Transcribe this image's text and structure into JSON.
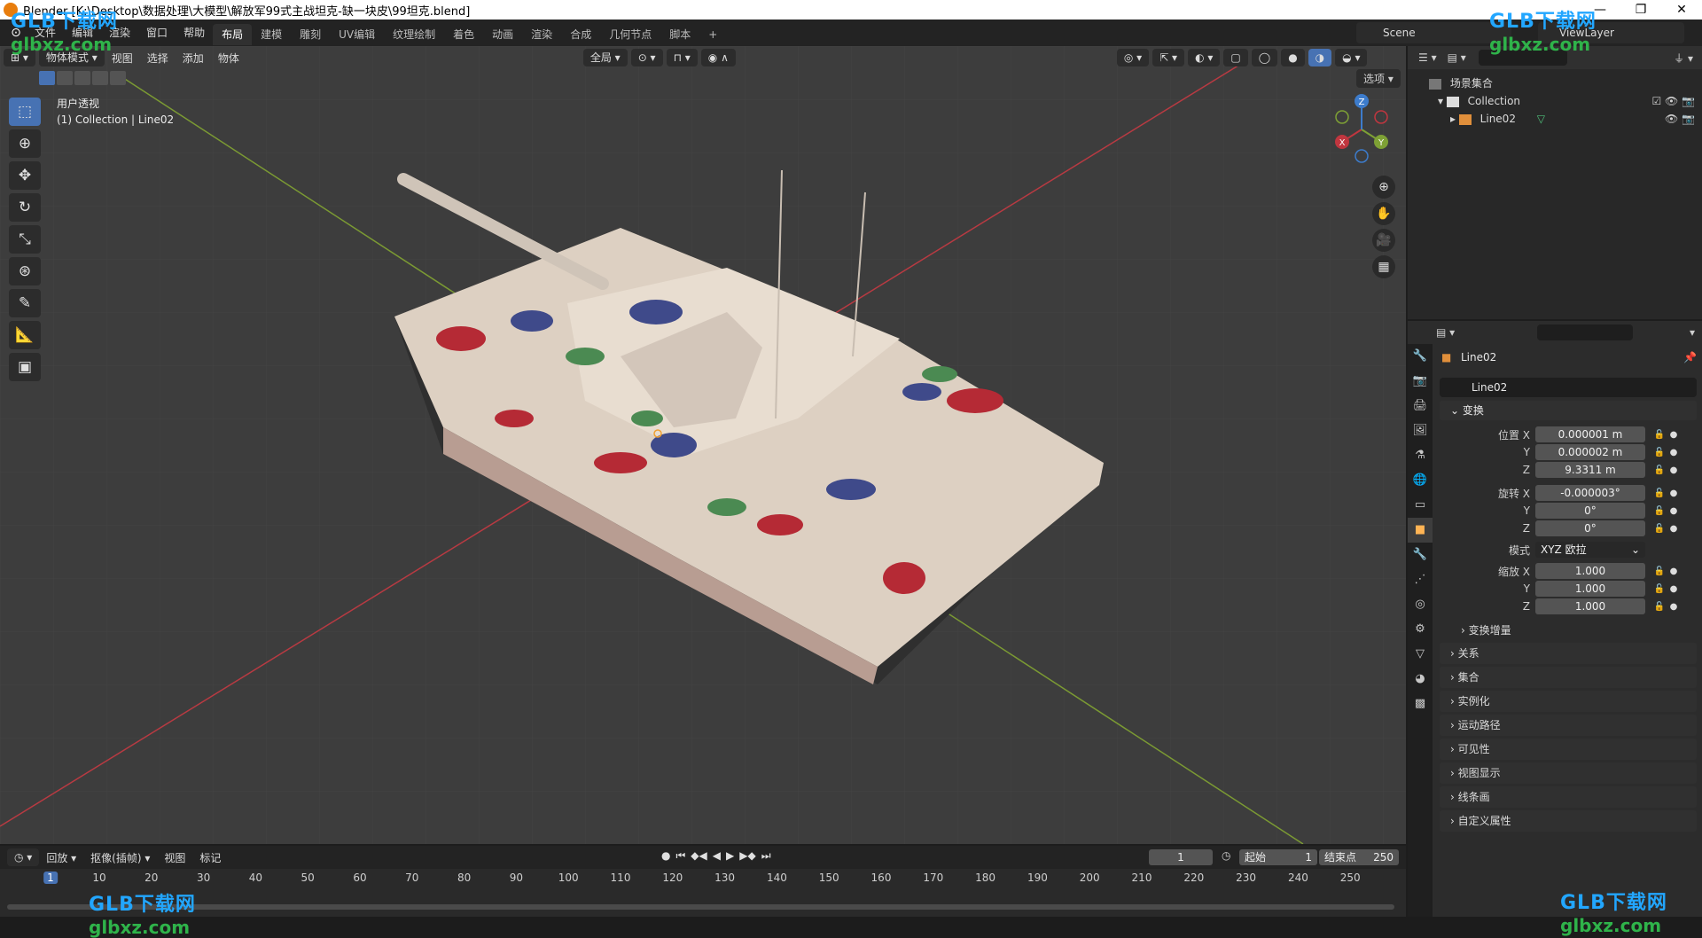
{
  "window": {
    "title": "Blender [K:\\Desktop\\数据处理\\大模型\\解放军99式主战坦克-缺一块皮\\99坦克.blend]",
    "controls": [
      "—",
      "❐",
      "✕"
    ]
  },
  "menubar": {
    "menus": [
      "文件",
      "编辑",
      "渲染",
      "窗口",
      "帮助"
    ],
    "workspaces": [
      "布局",
      "建模",
      "雕刻",
      "UV编辑",
      "纹理绘制",
      "着色",
      "动画",
      "渲染",
      "合成",
      "几何节点",
      "脚本"
    ],
    "active_workspace": "布局",
    "add_tab": "+",
    "scene": "Scene",
    "view_layer": "ViewLayer"
  },
  "viewport": {
    "mode": "物体模式",
    "menus": [
      "视图",
      "选择",
      "添加",
      "物体"
    ],
    "transform_orientation": "全局",
    "options": "选项",
    "view_name": "用户透视",
    "collection_info": "(1) Collection | Line02",
    "gizmo_axes": [
      "X",
      "Y",
      "Z"
    ],
    "tools": [
      "select-box",
      "cursor",
      "move",
      "rotate",
      "scale",
      "transform",
      "annotate",
      "measure",
      "add-cube"
    ]
  },
  "outliner": {
    "root": "场景集合",
    "items": [
      {
        "label": "Collection",
        "level": 1
      },
      {
        "label": "Line02",
        "level": 2
      }
    ]
  },
  "properties": {
    "object_title": "Line02",
    "object_name": "Line02",
    "transform_panel": "变换",
    "location_label": "位置 X",
    "rotation_label": "旋转 X",
    "scale_label": "缩放 X",
    "y_label": "Y",
    "z_label": "Z",
    "location": [
      "0.000001 m",
      "0.000002 m",
      "9.3311 m"
    ],
    "rotation": [
      "-0.000003°",
      "0°",
      "0°"
    ],
    "mode_label": "模式",
    "rotation_mode": "XYZ 欧拉",
    "scale": [
      "1.000",
      "1.000",
      "1.000"
    ],
    "delta_transform": "变换增量",
    "collapsed_panels": [
      "关系",
      "集合",
      "实例化",
      "运动路径",
      "可见性",
      "视图显示",
      "线条画",
      "自定义属性"
    ]
  },
  "timeline": {
    "menus": [
      "回放",
      "抠像(插帧)",
      "视图",
      "标记"
    ],
    "current_frame": "1",
    "start_label": "起始",
    "start": "1",
    "end_label": "结束点",
    "end": "250",
    "ruler": [
      "1",
      "10",
      "20",
      "30",
      "40",
      "50",
      "60",
      "70",
      "80",
      "90",
      "100",
      "110",
      "120",
      "130",
      "140",
      "150",
      "160",
      "170",
      "180",
      "190",
      "200",
      "210",
      "220",
      "230",
      "240",
      "250"
    ]
  },
  "watermark": {
    "line1": "GLB下载网",
    "line2": "glbxz.com"
  },
  "colors": {
    "accent": "#4772b3",
    "viewport_bg": "#3d3d3d",
    "x_axis": "#c0363f",
    "y_axis": "#7ea135",
    "z_axis": "#3d7ccc"
  }
}
